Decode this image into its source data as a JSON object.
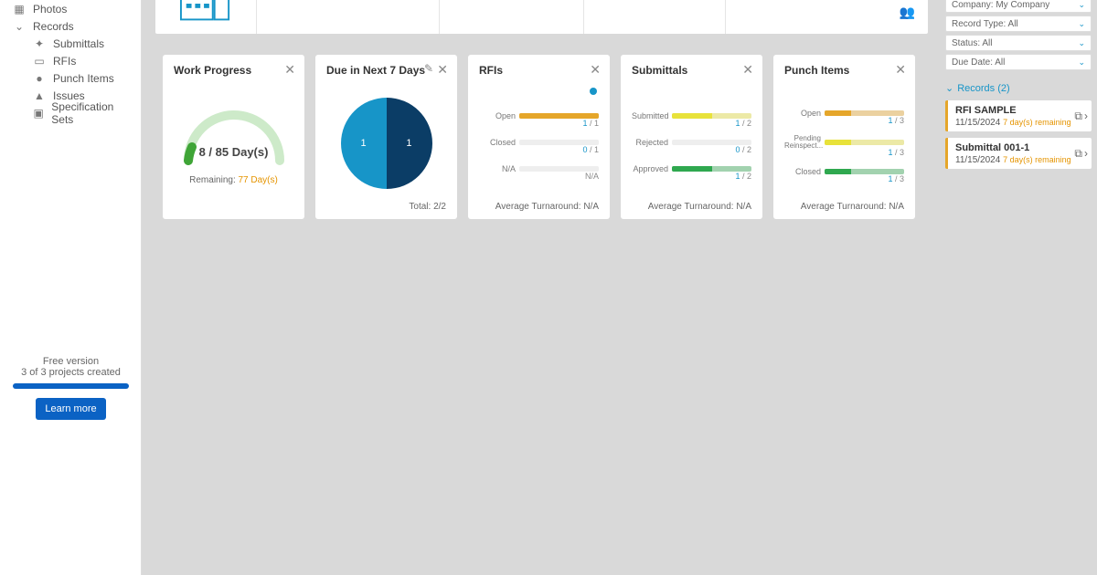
{
  "sidenav": {
    "photos": "Photos",
    "records": "Records",
    "submittals": "Submittals",
    "rfis": "RFIs",
    "punch": "Punch Items",
    "issues": "Issues",
    "specs": "Specification Sets"
  },
  "free": {
    "line1": "Free version",
    "line2": "3 of 3 projects created",
    "learn": "Learn more"
  },
  "cards": {
    "work": {
      "title": "Work Progress",
      "days": "8 / 85 Day(s)",
      "rem_label": "Remaining: ",
      "rem_val": "77 Day(s)"
    },
    "due": {
      "title": "Due in Next 7 Days",
      "left": "1",
      "right": "1",
      "foot": "Total: 2/2"
    },
    "rfis": {
      "title": "RFIs",
      "rows": [
        {
          "label": "Open",
          "val_n": "1",
          "val_d": " / 1",
          "color": "#e5a62a",
          "lightw": "100%",
          "fillw": "100%"
        },
        {
          "label": "Closed",
          "val_n": "0",
          "val_d": " / 1",
          "color": "#bbb",
          "lightw": "0%",
          "fillw": "0%"
        },
        {
          "label": "N/A",
          "val_n": "",
          "val_d": "N/A",
          "color": "#bbb",
          "lightw": "0%",
          "fillw": "0%"
        }
      ],
      "foot": "Average Turnaround: N/A"
    },
    "subs": {
      "title": "Submittals",
      "rows": [
        {
          "label": "Submitted",
          "val_n": "1",
          "val_d": " / 2",
          "color": "#e8e23a",
          "lightw": "100%",
          "fillw": "50%"
        },
        {
          "label": "Rejected",
          "val_n": "0",
          "val_d": " / 2",
          "color": "#bbb",
          "lightw": "0%",
          "fillw": "0%"
        },
        {
          "label": "Approved",
          "val_n": "1",
          "val_d": " / 2",
          "color": "#2fa84f",
          "lightw": "100%",
          "fillw": "50%"
        }
      ],
      "foot": "Average Turnaround: N/A"
    },
    "punch": {
      "title": "Punch Items",
      "rows": [
        {
          "label": "Open",
          "val_n": "1",
          "val_d": " / 3",
          "color": "#e5a62a",
          "lightw": "100%",
          "fillw": "33%"
        },
        {
          "label2": "Pending Reinspect...",
          "val_n": "1",
          "val_d": " / 3",
          "color": "#e8e23a",
          "lightw": "100%",
          "fillw": "33%"
        },
        {
          "label": "Closed",
          "val_n": "1",
          "val_d": " / 3",
          "color": "#2fa84f",
          "lightw": "100%",
          "fillw": "33%"
        }
      ],
      "foot": "Average Turnaround: N/A"
    }
  },
  "filters": {
    "company": "Company: My Company",
    "record_type": "Record Type: All",
    "status": "Status: All",
    "due": "Due Date: All"
  },
  "records": {
    "head": "Records (2)",
    "items": [
      {
        "name": "RFI SAMPLE",
        "date": "11/15/2024",
        "rem": "7 day(s) remaining"
      },
      {
        "name": "Submittal 001-1",
        "date": "11/15/2024",
        "rem": "7 day(s) remaining"
      }
    ]
  }
}
